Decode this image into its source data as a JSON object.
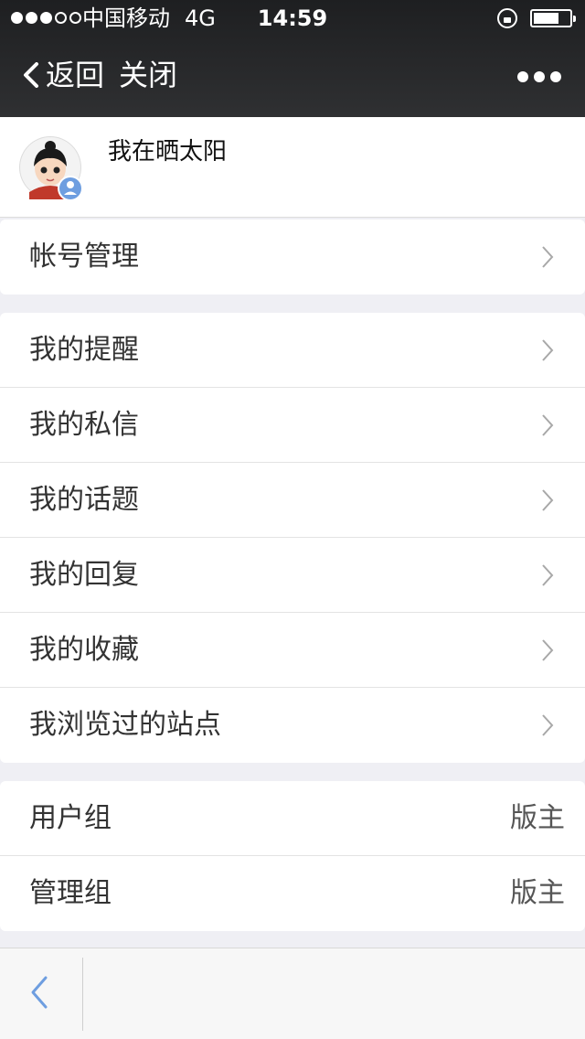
{
  "status_bar": {
    "carrier": "中国移动",
    "network": "4G",
    "time": "14:59",
    "signal_bars_filled": 3,
    "signal_bars_total": 5,
    "battery_level": 0.7
  },
  "nav": {
    "back_label": "返回",
    "close_label": "关闭",
    "more_icon": "more-dots-icon"
  },
  "profile": {
    "username": "我在晒太阳",
    "avatar_icon": "avatar-image",
    "badge_icon": "user-badge-icon"
  },
  "groups": {
    "account": [
      {
        "label": "帐号管理"
      }
    ],
    "menu": [
      {
        "label": "我的提醒"
      },
      {
        "label": "我的私信"
      },
      {
        "label": "我的话题"
      },
      {
        "label": "我的回复"
      },
      {
        "label": "我的收藏"
      },
      {
        "label": "我浏览过的站点"
      }
    ],
    "info": [
      {
        "label": "用户组",
        "value": "版主"
      },
      {
        "label": "管理组",
        "value": "版主"
      }
    ]
  },
  "bottom_bar": {
    "back_icon": "chevron-left-icon"
  },
  "colors": {
    "navbar_bg": "#1e1f21",
    "page_bg": "#efeff4",
    "accent_blue": "#6e9ee0"
  }
}
